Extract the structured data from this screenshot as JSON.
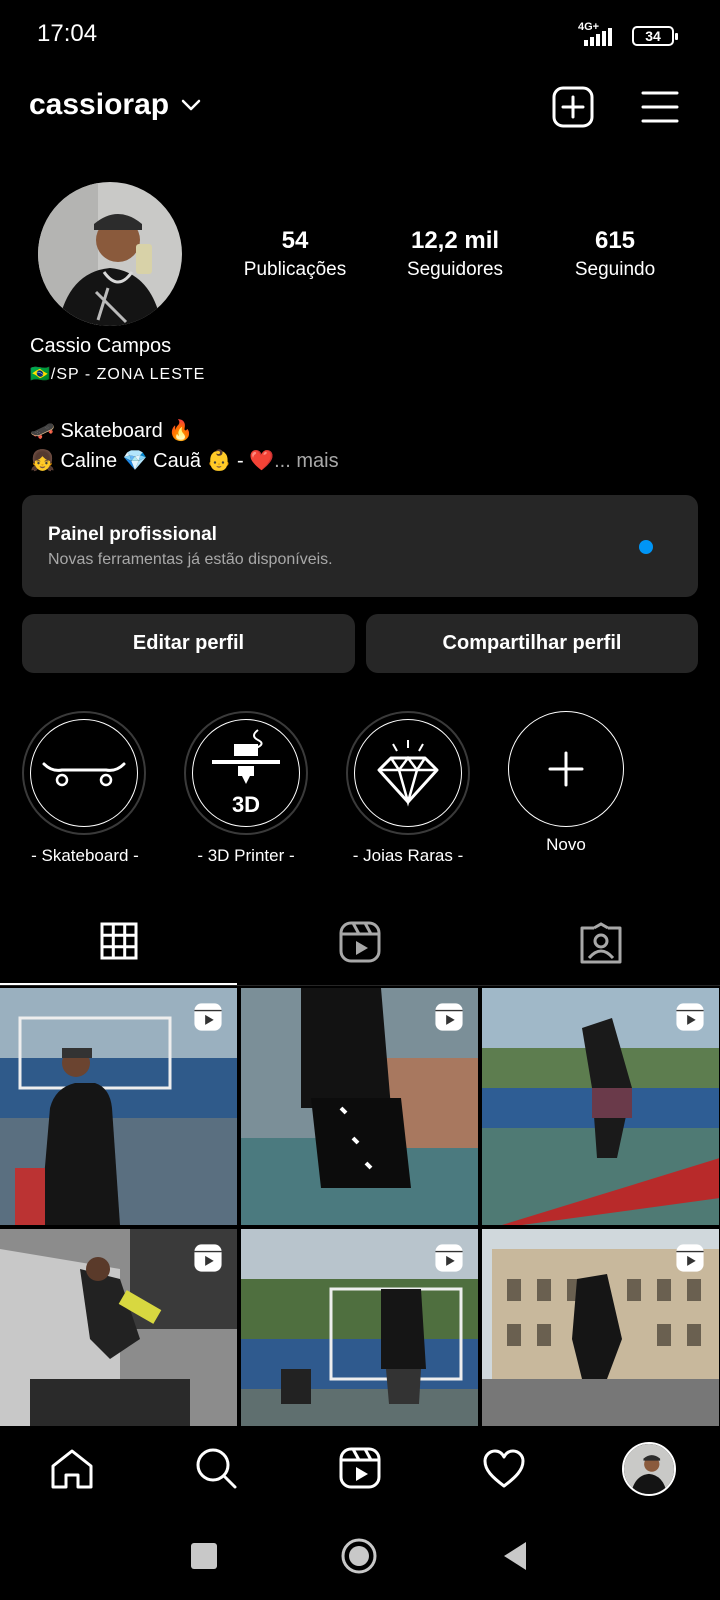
{
  "status_bar": {
    "time": "17:04",
    "network": "4G+",
    "battery": "34"
  },
  "header": {
    "username": "cassiorap",
    "icons": [
      "chevron-down-icon",
      "new-post-icon",
      "menu-icon"
    ]
  },
  "profile": {
    "stats": [
      {
        "value": "54",
        "label": "Publicações"
      },
      {
        "value": "12,2 mil",
        "label": "Seguidores"
      },
      {
        "value": "615",
        "label": "Seguindo"
      }
    ],
    "name": "Cassio Campos",
    "location": "🇧🇷/SP - ZONA LESTE",
    "bio_line1": "🛹 Skateboard 🔥",
    "bio_line2": "👧 Caline 💎 Cauã 👶 - ❤️",
    "more": "... mais"
  },
  "pro_panel": {
    "title": "Painel profissional",
    "subtitle": "Novas ferramentas já estão disponíveis."
  },
  "buttons": {
    "edit": "Editar perfil",
    "share": "Compartilhar perfil"
  },
  "highlights": [
    {
      "label": "- Skateboard -",
      "icon": "skateboard-icon"
    },
    {
      "label": "- 3D Printer -",
      "icon": "3d-printer-icon",
      "glyph": "3D"
    },
    {
      "label": "- Joias Raras -",
      "icon": "diamond-icon"
    },
    {
      "label": "Novo",
      "icon": "plus-icon"
    }
  ],
  "tabs": [
    "grid-icon",
    "reels-icon",
    "tagged-icon"
  ],
  "posts": [
    {
      "type": "reel"
    },
    {
      "type": "reel"
    },
    {
      "type": "reel"
    },
    {
      "type": "reel"
    },
    {
      "type": "reel"
    },
    {
      "type": "reel"
    }
  ],
  "bottom_nav": [
    "home-icon",
    "search-icon",
    "reels-icon",
    "heart-icon",
    "profile-avatar"
  ],
  "colors": {
    "background": "#000000",
    "panel": "#262626",
    "accent": "#0095f6",
    "muted": "#a8a8a8"
  }
}
